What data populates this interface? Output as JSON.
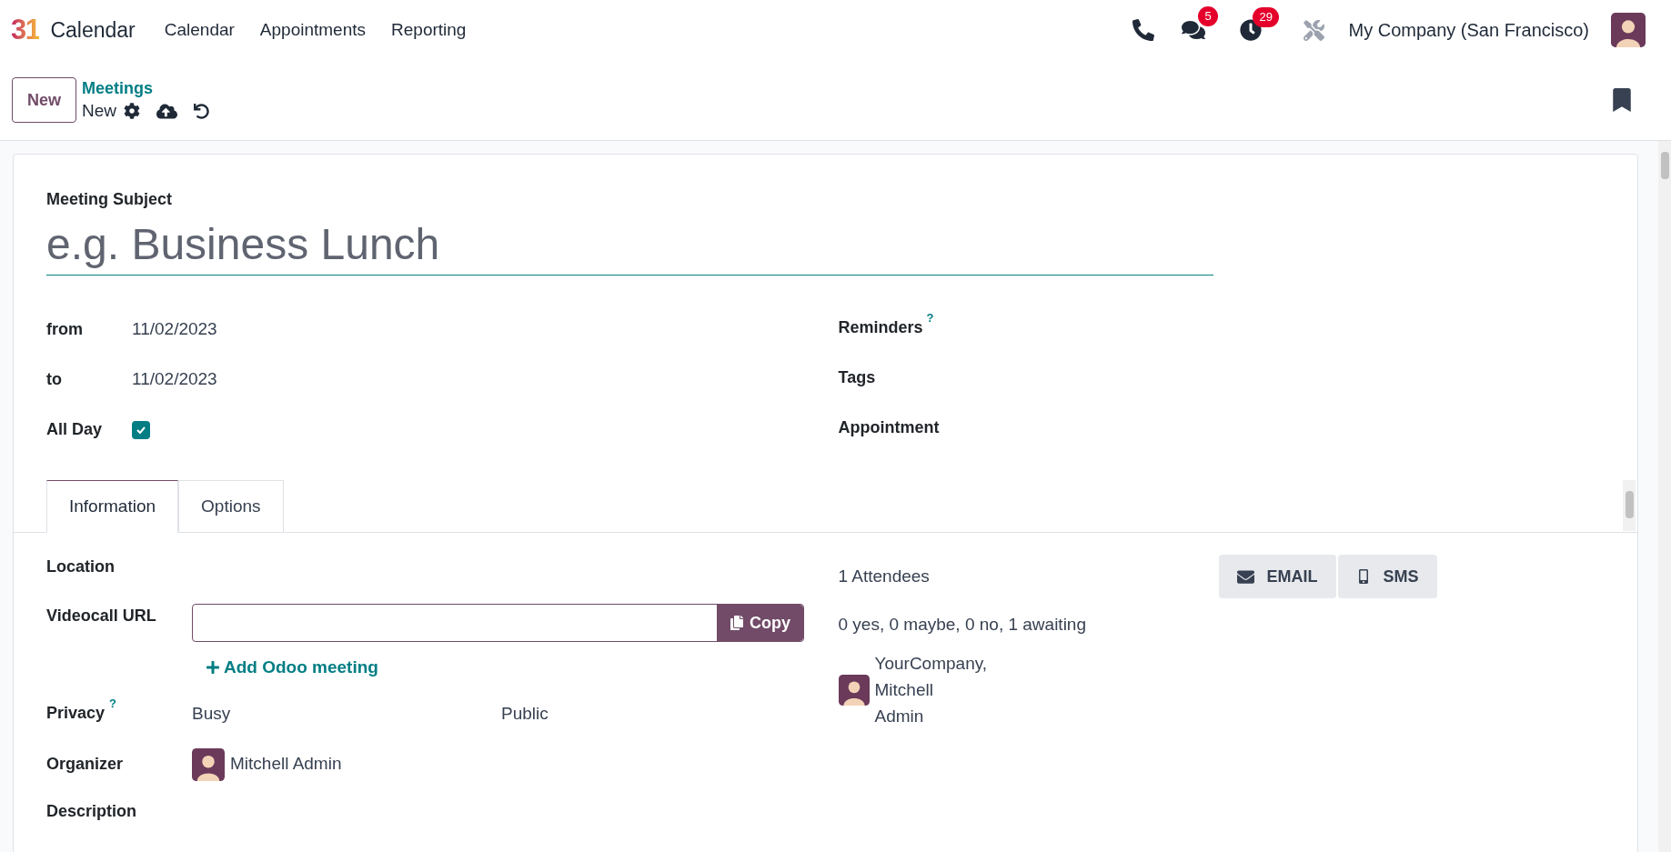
{
  "navbar": {
    "logo": "31",
    "app_name": "Calendar",
    "menu": [
      {
        "label": "Calendar"
      },
      {
        "label": "Appointments"
      },
      {
        "label": "Reporting"
      }
    ],
    "messages_badge": "5",
    "activities_badge": "29",
    "company": "My Company (San Francisco)"
  },
  "control_panel": {
    "new_button": "New",
    "breadcrumb": "Meetings",
    "record": "New"
  },
  "form": {
    "subject_label": "Meeting Subject",
    "subject_placeholder": "e.g. Business Lunch",
    "left_fields": [
      {
        "kind": "text",
        "label": "from",
        "value": "11/02/2023"
      },
      {
        "kind": "text",
        "label": "to",
        "value": "11/02/2023"
      },
      {
        "kind": "checkbox",
        "label": "All Day",
        "checked": true
      }
    ],
    "right_fields": [
      {
        "label": "Reminders",
        "help": "?"
      },
      {
        "label": "Tags"
      },
      {
        "label": "Appointment"
      }
    ],
    "tabs": [
      {
        "label": "Information",
        "selected": true
      },
      {
        "label": "Options",
        "selected": false
      }
    ],
    "information": {
      "location_label": "Location",
      "videocall_label": "Videocall URL",
      "copy_button": "Copy",
      "add_meeting_link": "Add Odoo meeting",
      "privacy_label": "Privacy",
      "privacy_help": "?",
      "privacy_show_as": "Busy",
      "privacy_value": "Public",
      "organizer_label": "Organizer",
      "organizer_name": "Mitchell Admin",
      "description_label": "Description"
    },
    "attendees": {
      "count": "1 Attendees",
      "summary": "0 yes, 0 maybe, 0 no, 1 awaiting",
      "email_button": "EMAIL",
      "sms_button": "SMS",
      "people": [
        {
          "name_lines": [
            "YourCompany,",
            "Mitchell",
            "Admin"
          ]
        }
      ]
    }
  }
}
